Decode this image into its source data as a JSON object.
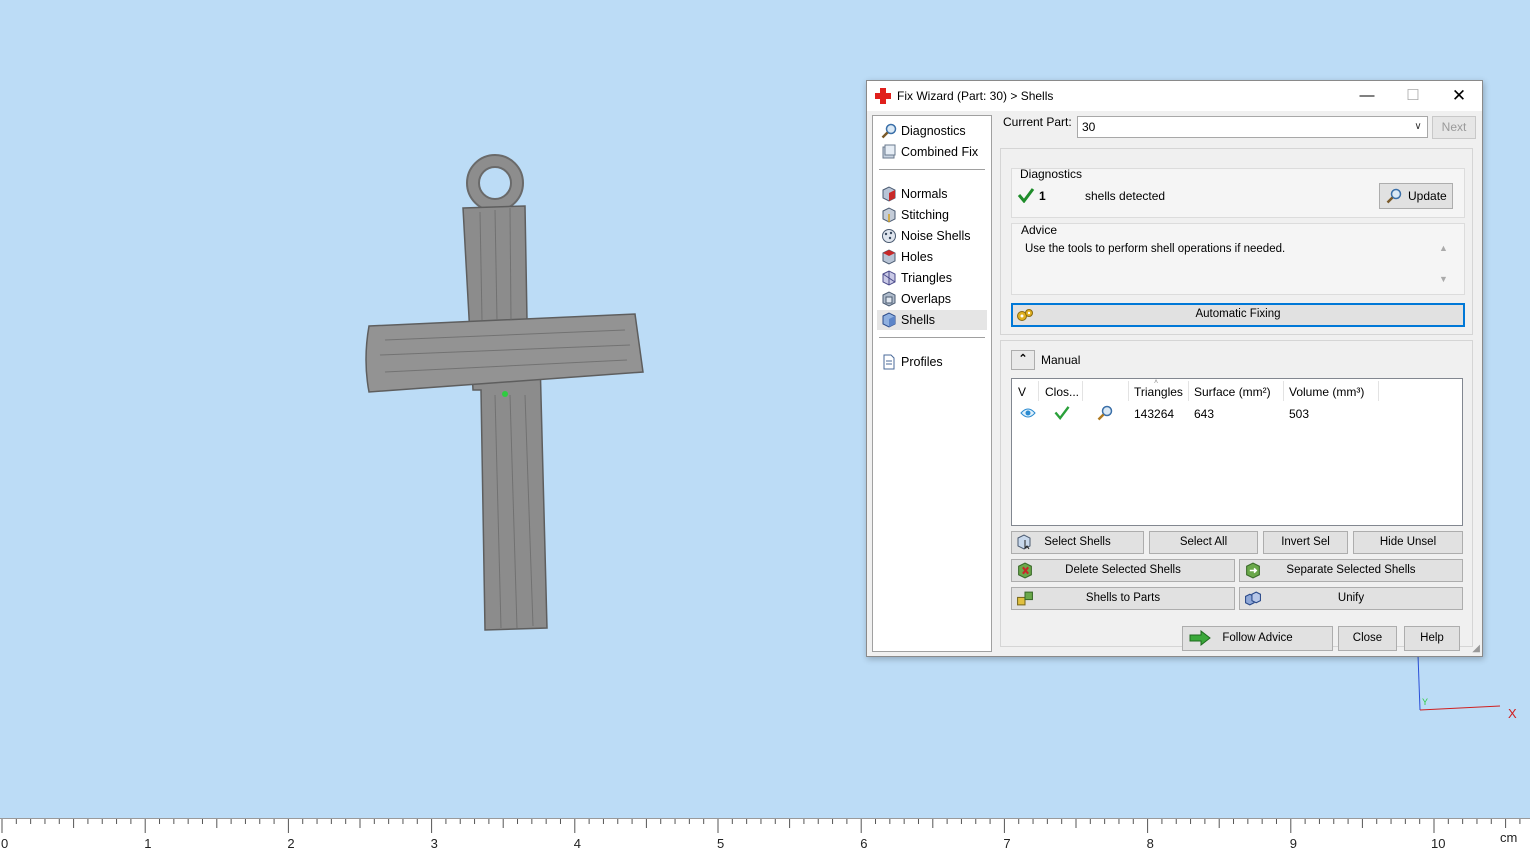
{
  "dialog": {
    "title": "Fix Wizard (Part: 30) > Shells",
    "window_controls": {
      "minimize": "—",
      "maximize": "☐",
      "close": "✕"
    },
    "nav": {
      "items": [
        {
          "label": "Diagnostics",
          "icon": "magnifier-icon"
        },
        {
          "label": "Combined Fix",
          "icon": "combined-fix-icon"
        },
        {
          "label": "Normals",
          "icon": "normals-cube-icon"
        },
        {
          "label": "Stitching",
          "icon": "stitching-cube-icon"
        },
        {
          "label": "Noise Shells",
          "icon": "noise-shells-icon"
        },
        {
          "label": "Holes",
          "icon": "holes-cube-icon"
        },
        {
          "label": "Triangles",
          "icon": "triangles-cube-icon"
        },
        {
          "label": "Overlaps",
          "icon": "overlaps-cube-icon"
        },
        {
          "label": "Shells",
          "icon": "shells-cube-icon",
          "active": true
        },
        {
          "label": "Profiles",
          "icon": "document-icon"
        }
      ]
    },
    "current_part": {
      "label": "Current Part:",
      "value": "30"
    },
    "next_label": "Next",
    "diagnostics": {
      "title": "Diagnostics",
      "count": "1",
      "text": "shells detected",
      "update_label": "Update"
    },
    "advice": {
      "title": "Advice",
      "text": "Use the tools to perform shell operations if needed."
    },
    "automatic_fixing_label": "Automatic Fixing",
    "manual": {
      "title": "Manual",
      "toggle": "⌃",
      "columns": [
        "V",
        "Clos...",
        "",
        "Triangles",
        "Surface (mm²)",
        "Volume (mm³)"
      ],
      "rows": [
        {
          "visible": "eye-icon",
          "closed": "check-icon",
          "tool": "magnifier-icon",
          "triangles": "143264",
          "surface": "643",
          "volume": "503"
        }
      ],
      "buttons": {
        "select_shells": "Select Shells",
        "select_all": "Select All",
        "invert_sel": "Invert Sel",
        "hide_unsel": "Hide Unsel",
        "delete_selected": "Delete Selected Shells",
        "separate_selected": "Separate Selected Shells",
        "shells_to_parts": "Shells to Parts",
        "unify": "Unify"
      }
    },
    "follow_advice_label": "Follow Advice",
    "close_label": "Close",
    "help_label": "Help"
  },
  "ruler": {
    "labels": [
      "0",
      "1",
      "2",
      "3",
      "4",
      "5",
      "6",
      "7",
      "8",
      "9",
      "10"
    ],
    "unit": "cm"
  },
  "axes": {
    "x_label": "X",
    "y_label": "Y"
  },
  "colors": {
    "viewport_bg": "#bcdcf6",
    "accent": "#0078d7",
    "model": "#8c8c8c"
  }
}
